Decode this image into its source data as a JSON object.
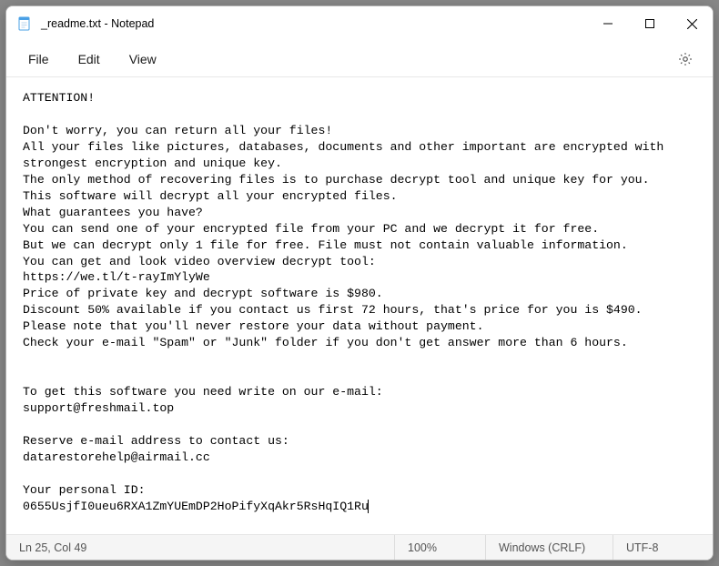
{
  "titlebar": {
    "title": "_readme.txt - Notepad"
  },
  "menubar": {
    "file": "File",
    "edit": "Edit",
    "view": "View"
  },
  "content": {
    "text": "ATTENTION!\n\nDon't worry, you can return all your files!\nAll your files like pictures, databases, documents and other important are encrypted with strongest encryption and unique key.\nThe only method of recovering files is to purchase decrypt tool and unique key for you.\nThis software will decrypt all your encrypted files.\nWhat guarantees you have?\nYou can send one of your encrypted file from your PC and we decrypt it for free.\nBut we can decrypt only 1 file for free. File must not contain valuable information.\nYou can get and look video overview decrypt tool:\nhttps://we.tl/t-rayImYlyWe\nPrice of private key and decrypt software is $980.\nDiscount 50% available if you contact us first 72 hours, that's price for you is $490.\nPlease note that you'll never restore your data without payment.\nCheck your e-mail \"Spam\" or \"Junk\" folder if you don't get answer more than 6 hours.\n\n\nTo get this software you need write on our e-mail:\nsupport@freshmail.top\n\nReserve e-mail address to contact us:\ndatarestorehelp@airmail.cc\n\nYour personal ID:\n0655UsjfI0ueu6RXA1ZmYUEmDP2HoPifyXqAkr5RsHqIQ1Ru"
  },
  "statusbar": {
    "position": "Ln 25, Col 49",
    "zoom": "100%",
    "encoding": "Windows (CRLF)",
    "charset": "UTF-8"
  }
}
